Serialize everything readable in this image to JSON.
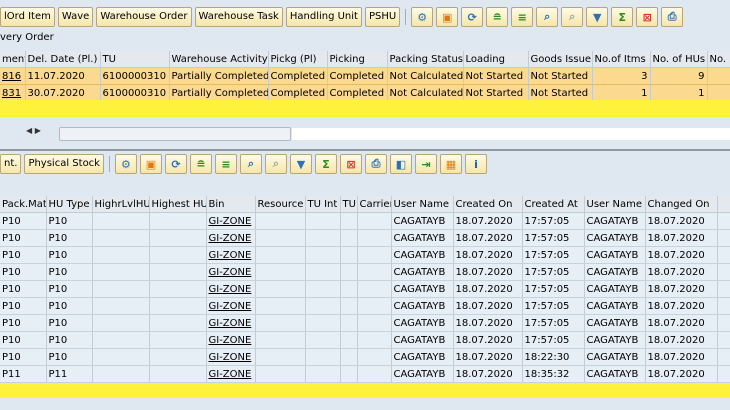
{
  "toolbar1": {
    "buttons": [
      "lOrd Item",
      "Wave",
      "Warehouse Order",
      "Warehouse Task",
      "Handling Unit",
      "PSHU"
    ],
    "icons": [
      "settings-icon",
      "layout-icon",
      "refresh-icon",
      "sort-asc-icon",
      "sort-desc-icon",
      "find-icon",
      "find-next-icon",
      "filter-icon",
      "sum-icon",
      "subtotal-icon",
      "print-icon"
    ]
  },
  "section_label": "very Order",
  "top_table": {
    "columns": [
      "ment",
      "Del. Date (Pl.)",
      "TU",
      "Warehouse Activity",
      "Pickg (Pl)",
      "Picking",
      "Packing Status",
      "Loading",
      "Goods Issue",
      "No.of Itms",
      "No. of HUs",
      "No."
    ],
    "rows": [
      [
        "816",
        "11.07.2020",
        "6100000310",
        "Partially Completed",
        "Completed",
        "Completed",
        "Not Calculated",
        "Not Started",
        "Not Started",
        "3",
        "9",
        ""
      ],
      [
        "831",
        "30.07.2020",
        "6100000310",
        "Partially Completed",
        "Completed",
        "Completed",
        "Not Calculated",
        "Not Started",
        "Not Started",
        "1",
        "1",
        ""
      ]
    ]
  },
  "toolbar2": {
    "buttons": [
      "nt.",
      "Physical Stock"
    ],
    "icons": [
      "settings-icon",
      "layout-icon",
      "refresh-icon",
      "sort-asc-icon",
      "sort-desc-icon",
      "find-icon",
      "find-next-icon",
      "filter-icon",
      "sum-icon",
      "subtotal-icon",
      "print-icon",
      "view-icon",
      "export-icon",
      "columns-icon",
      "info-icon"
    ]
  },
  "bottom_table": {
    "columns": [
      "Pack.Mat.",
      "HU Type",
      "HighrLvlHU",
      "Highest HU",
      "Bin",
      "Resource",
      "TU Int",
      "TU",
      "Carrier",
      "User Name",
      "Created On",
      "Created At",
      "User Name",
      "Changed On",
      ""
    ],
    "rows": [
      [
        "P10",
        "P10",
        "",
        "",
        "GI-ZONE",
        "",
        "",
        "",
        "",
        "CAGATAYB",
        "18.07.2020",
        "17:57:05",
        "CAGATAYB",
        "18.07.2020",
        ""
      ],
      [
        "P10",
        "P10",
        "",
        "",
        "GI-ZONE",
        "",
        "",
        "",
        "",
        "CAGATAYB",
        "18.07.2020",
        "17:57:05",
        "CAGATAYB",
        "18.07.2020",
        ""
      ],
      [
        "P10",
        "P10",
        "",
        "",
        "GI-ZONE",
        "",
        "",
        "",
        "",
        "CAGATAYB",
        "18.07.2020",
        "17:57:05",
        "CAGATAYB",
        "18.07.2020",
        ""
      ],
      [
        "P10",
        "P10",
        "",
        "",
        "GI-ZONE",
        "",
        "",
        "",
        "",
        "CAGATAYB",
        "18.07.2020",
        "17:57:05",
        "CAGATAYB",
        "18.07.2020",
        ""
      ],
      [
        "P10",
        "P10",
        "",
        "",
        "GI-ZONE",
        "",
        "",
        "",
        "",
        "CAGATAYB",
        "18.07.2020",
        "17:57:05",
        "CAGATAYB",
        "18.07.2020",
        ""
      ],
      [
        "P10",
        "P10",
        "",
        "",
        "GI-ZONE",
        "",
        "",
        "",
        "",
        "CAGATAYB",
        "18.07.2020",
        "17:57:05",
        "CAGATAYB",
        "18.07.2020",
        ""
      ],
      [
        "P10",
        "P10",
        "",
        "",
        "GI-ZONE",
        "",
        "",
        "",
        "",
        "CAGATAYB",
        "18.07.2020",
        "17:57:05",
        "CAGATAYB",
        "18.07.2020",
        ""
      ],
      [
        "P10",
        "P10",
        "",
        "",
        "GI-ZONE",
        "",
        "",
        "",
        "",
        "CAGATAYB",
        "18.07.2020",
        "17:57:05",
        "CAGATAYB",
        "18.07.2020",
        ""
      ],
      [
        "P10",
        "P10",
        "",
        "",
        "GI-ZONE",
        "",
        "",
        "",
        "",
        "CAGATAYB",
        "18.07.2020",
        "18:22:30",
        "CAGATAYB",
        "18.07.2020",
        ""
      ],
      [
        "P11",
        "P11",
        "",
        "",
        "GI-ZONE",
        "",
        "",
        "",
        "",
        "CAGATAYB",
        "18.07.2020",
        "18:35:32",
        "CAGATAYB",
        "18.07.2020",
        ""
      ]
    ]
  }
}
